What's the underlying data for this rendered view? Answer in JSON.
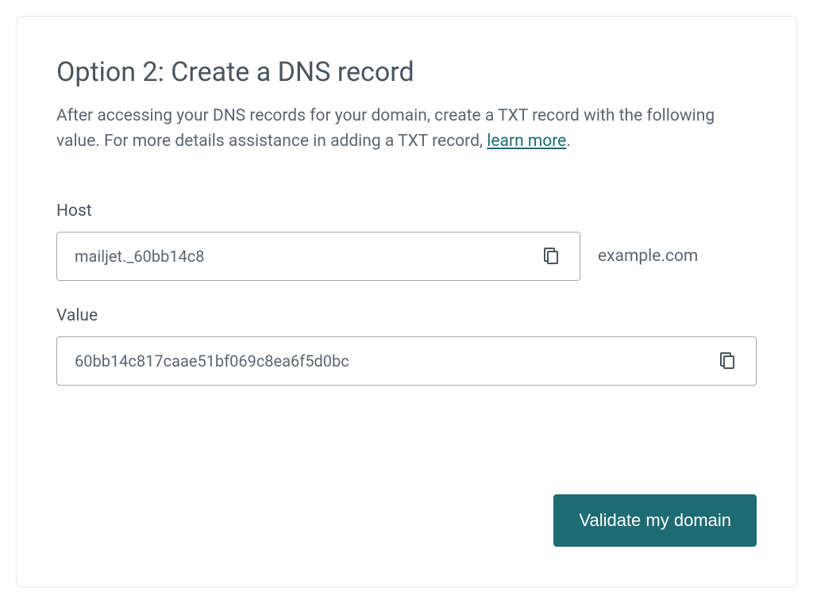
{
  "title": "Option 2: Create a DNS record",
  "description_prefix": "After accessing your DNS records for your domain, create a TXT record with the following value. For more details assistance in adding a TXT record, ",
  "description_link": "learn more",
  "description_suffix": ".",
  "host": {
    "label": "Host",
    "value": "mailjet._60bb14c8",
    "domain_suffix": "example.com"
  },
  "value_field": {
    "label": "Value",
    "value": "60bb14c817caae51bf069c8ea6f5d0bc"
  },
  "validate_button": "Validate my domain"
}
